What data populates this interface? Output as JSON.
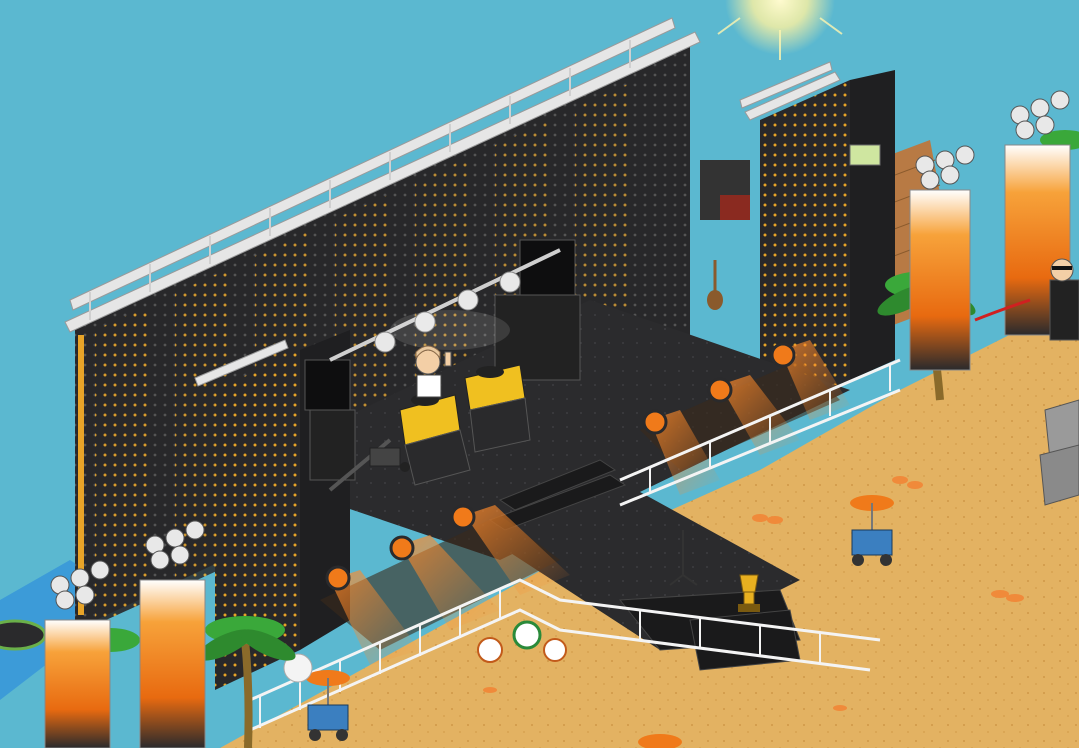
{
  "scene": {
    "colors": {
      "sky": "#5bb8d0",
      "sand": "#e3b262",
      "sand_dark": "#c98f3f",
      "panel": "#2a2a2c",
      "panel_dark": "#1a1a1b",
      "panel_light": "#3a3a3c",
      "light_dot": "#f0b030",
      "rail": "#e6e6e6",
      "fence": "#f4f4f4",
      "orange": "#f07a1a",
      "glow": "#ff9a3a",
      "palm": "#3aa83a",
      "wood": "#b87a44",
      "water": "#3c9bd8"
    }
  }
}
